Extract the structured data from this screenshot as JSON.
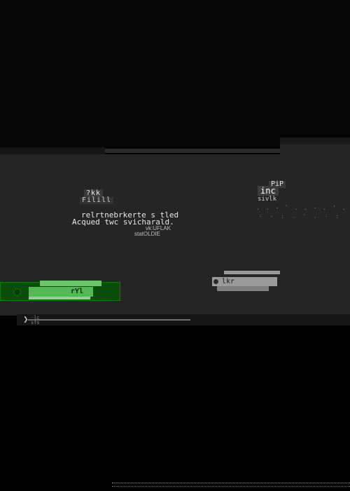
{
  "dialog": {
    "left_title_badge": "?kk",
    "left_title_sub": "Filill",
    "message_line1": "relrtnebrkerte s tled",
    "message_line2": "Acqued twc svicharald.",
    "meta_line1": "vk:UFLAK",
    "meta_line2": "statOLDIE",
    "right_badge": "PiP",
    "right_chip": "inc",
    "right_sub": "sivlk",
    "right_noise_line1": ". . · ` . . · . ' . ' .",
    "right_noise_line2": "· · : . ' . · :"
  },
  "buttons": {
    "primary_label": "rYl",
    "secondary_label": "lkr"
  },
  "statusbar": {
    "text_line1": "·lc",
    "text_line2": "sfs"
  },
  "colors": {
    "background": "#000000",
    "panel": "#252525",
    "primary_button": "#0b4e0b",
    "primary_highlight": "#54b954",
    "secondary_button": "#9a9a9a"
  },
  "icons": {
    "primary_button_icon": "circle-icon",
    "secondary_button_icon": "circle-icon",
    "status_icon": "chevron-right-icon"
  }
}
